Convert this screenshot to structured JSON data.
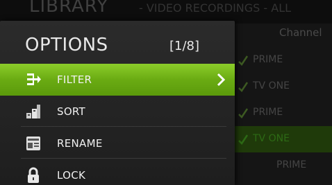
{
  "background": {
    "title": "LIBRARY",
    "subtitle": "- VIDEO RECORDINGS - ALL",
    "channel_header": "Channel",
    "channels": [
      {
        "name": "PRIME",
        "checked": true,
        "highlighted": false
      },
      {
        "name": "TV ONE",
        "checked": true,
        "highlighted": false
      },
      {
        "name": "PRIME",
        "checked": true,
        "highlighted": false
      },
      {
        "name": "TV ONE",
        "checked": true,
        "highlighted": true
      },
      {
        "name": "PRIME",
        "checked": false,
        "highlighted": false
      }
    ]
  },
  "options": {
    "title": "OPTIONS",
    "page": "[1/8]",
    "items": [
      {
        "label": "FILTER",
        "icon": "filter-icon",
        "selected": true
      },
      {
        "label": "SORT",
        "icon": "sort-icon",
        "selected": false
      },
      {
        "label": "RENAME",
        "icon": "rename-icon",
        "selected": false
      },
      {
        "label": "LOCK",
        "icon": "lock-icon",
        "selected": false
      }
    ]
  },
  "colors": {
    "accent": "#6aab13",
    "panel": "#262626",
    "text": "#f0f0f0"
  }
}
